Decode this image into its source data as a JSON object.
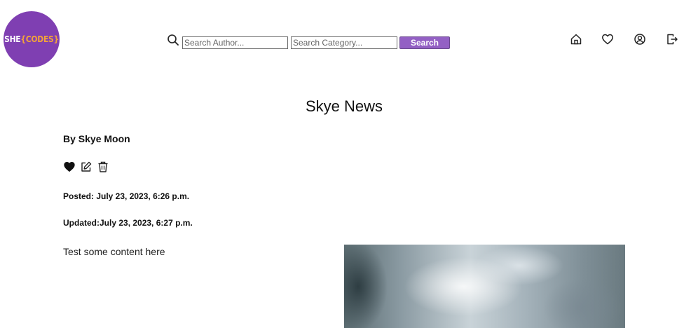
{
  "logo": {
    "part1": "SHE",
    "part2": "{CODES}"
  },
  "search": {
    "author_placeholder": "Search Author...",
    "category_placeholder": "Search Category...",
    "button_label": "Search"
  },
  "nav": {
    "icons": [
      "home-icon",
      "heart-icon",
      "user-icon",
      "logout-icon"
    ]
  },
  "post": {
    "title": "Skye News",
    "author": "By Skye Moon",
    "posted": "Posted: July 23, 2023, 6:26 p.m.",
    "updated": "Updated:July 23, 2023, 6:27 p.m.",
    "content": "Test some content here",
    "actions": [
      "heart-filled-icon",
      "edit-icon",
      "trash-icon"
    ]
  },
  "colors": {
    "logo_bg": "#7f3fb2",
    "logo_accent": "#f2a23a",
    "search_button": "#9360c4"
  }
}
